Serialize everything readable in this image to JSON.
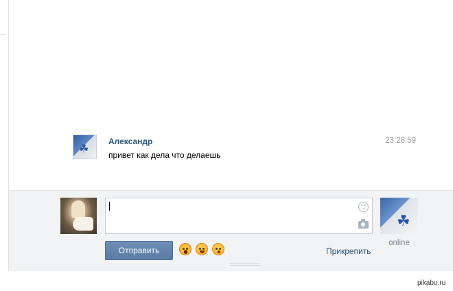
{
  "message": {
    "author": "Александр",
    "time": "23:28:59",
    "text": "привет как дела что делаешь",
    "avatar_icon": "adidas-logo-avatar"
  },
  "composer": {
    "input_value": "",
    "send_label": "Отправить",
    "attach_label": "Прикрепить",
    "emojis": [
      "scared-face-emoji",
      "blushing-smile-emoji",
      "kissing-face-emoji"
    ],
    "peer_status": "online"
  },
  "watermark": "pikabu.ru",
  "colors": {
    "link": "#2b587a",
    "button": "#5a7ba4",
    "composer_bg": "#f2f3f5"
  }
}
